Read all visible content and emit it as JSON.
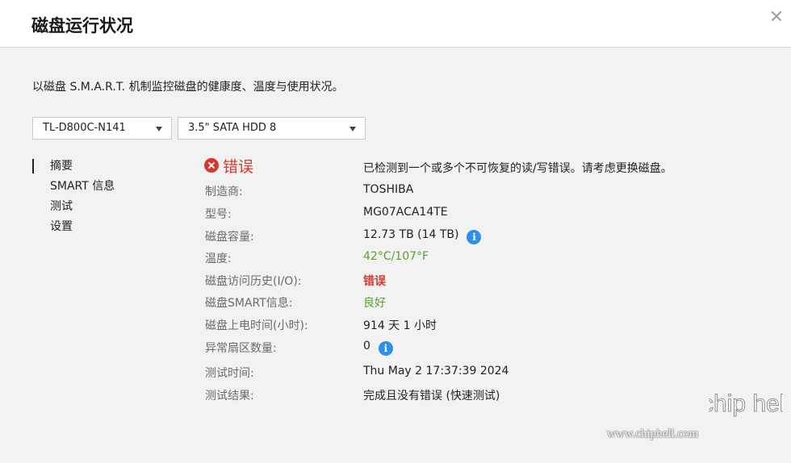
{
  "dialog": {
    "title": "磁盘运行状况",
    "description": "以磁盘 S.M.A.R.T. 机制监控磁盘的健康度、温度与使用状况。"
  },
  "selectors": {
    "device": "TL-D800C-N141",
    "disk": "3.5\" SATA HDD 8"
  },
  "nav": {
    "items": [
      {
        "label": "摘要",
        "active": true
      },
      {
        "label": "SMART 信息",
        "active": false
      },
      {
        "label": "测试",
        "active": false
      },
      {
        "label": "设置",
        "active": false
      }
    ]
  },
  "summary": {
    "status": "错误",
    "status_message": "已检测到一个或多个不可恢复的读/写错误。请考虑更换磁盘。",
    "rows": [
      {
        "label": "制造商:",
        "value": "TOSHIBA"
      },
      {
        "label": "型号:",
        "value": "MG07ACA14TE"
      },
      {
        "label": "磁盘容量:",
        "value": "12.73 TB (14 TB)"
      },
      {
        "label": "温度:",
        "value": "42°C/107°F"
      },
      {
        "label": "磁盘访问历史(I/O):",
        "value": "错误"
      },
      {
        "label": "磁盘SMART信息:",
        "value": "良好"
      },
      {
        "label": "磁盘上电时间(小时):",
        "value": "914 天 1 小时"
      },
      {
        "label": "异常扇区数量:",
        "value": "0"
      },
      {
        "label": "测试时间:",
        "value": "Thu May 2 17:37:39 2024"
      },
      {
        "label": "测试结果:",
        "value": "完成且没有错误 (快速测试)"
      }
    ]
  },
  "watermark": {
    "url": "www.chiphell.com",
    "logo_text": "chip hell"
  },
  "colors": {
    "error": "#d7382b",
    "good": "#5aa02c",
    "info": "#2f8fe6"
  },
  "icons": {
    "info_glyph": "i"
  }
}
